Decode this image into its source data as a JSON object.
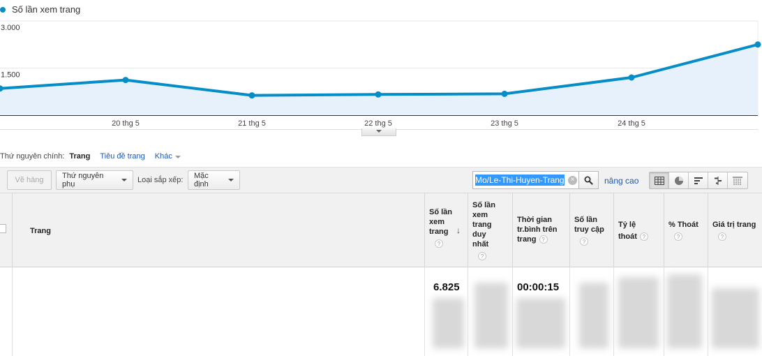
{
  "chart": {
    "legend_label": "Số lần xem trang",
    "y_ticks": [
      "3.000",
      "1.500"
    ],
    "x_ticks": [
      "20 thg 5",
      "21 thg 5",
      "22 thg 5",
      "23 thg 5",
      "24 thg 5"
    ],
    "colors": {
      "line": "#058dc7",
      "fill": "#e6f1fb"
    }
  },
  "chart_data": {
    "type": "area",
    "series": [
      {
        "name": "Số lần xem trang",
        "values": [
          850,
          1120,
          630,
          660,
          680,
          1200,
          2250
        ]
      }
    ],
    "x": [
      "",
      "20 thg 5",
      "21 thg 5",
      "22 thg 5",
      "23 thg 5",
      "24 thg 5",
      ""
    ],
    "ylim": [
      0,
      3000
    ],
    "grid": true,
    "legend": "top-left"
  },
  "dimension": {
    "label": "Thứ nguyên chính:",
    "active": "Trang",
    "options": [
      "Tiêu đề trang"
    ],
    "more_label": "Khác"
  },
  "toolbar": {
    "plot_rows_label": "Vẽ hàng",
    "secondary_dimension_label": "Thứ nguyên phụ",
    "sort_type_label": "Loại sắp xếp:",
    "sort_type_value": "Mặc định",
    "search_value": "Mo/Le-Thi-Huyen-Trang",
    "advanced_label": "nâng cao"
  },
  "table": {
    "columns": [
      {
        "key": "page",
        "label": "Trang"
      },
      {
        "key": "pageviews",
        "label_lines": [
          "Số lần",
          "xem",
          "trang"
        ]
      },
      {
        "key": "unique",
        "label_lines": [
          "Số lần",
          "xem",
          "trang",
          "duy",
          "nhất"
        ]
      },
      {
        "key": "avg_time",
        "label_lines": [
          "Thời gian",
          "tr.bình trên",
          "trang"
        ]
      },
      {
        "key": "entrances",
        "label_lines": [
          "Số lần",
          "truy cập"
        ]
      },
      {
        "key": "bounce",
        "label_lines": [
          "Tỷ lệ",
          "thoát"
        ]
      },
      {
        "key": "exit",
        "label_lines": [
          "% Thoát"
        ]
      },
      {
        "key": "value",
        "label_lines": [
          "Giá trị trang"
        ]
      }
    ],
    "totals": {
      "pageviews": "6.825",
      "avg_time": "00:00:15"
    }
  }
}
